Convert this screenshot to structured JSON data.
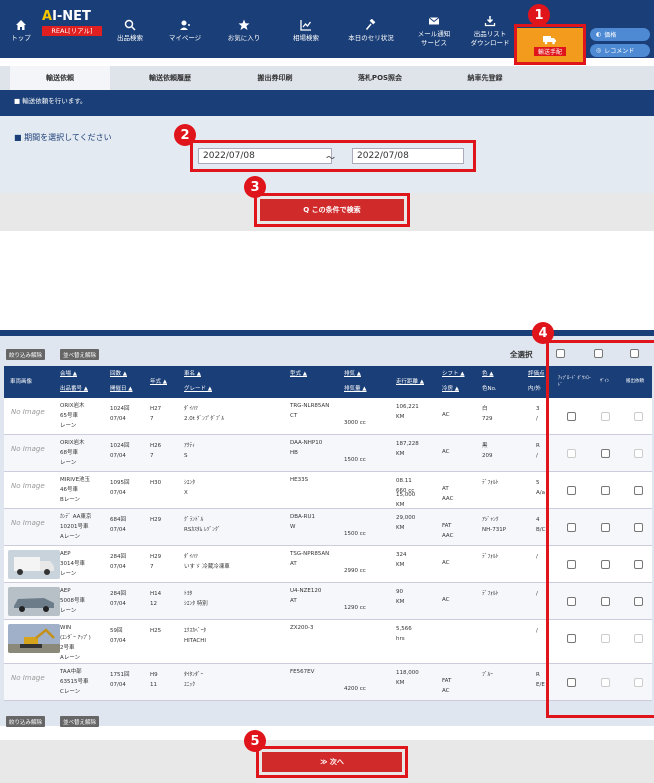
{
  "header": {
    "logo_main": "AI-NET",
    "logo_sub": "REAL[リアル]",
    "nav": [
      {
        "label": "トップ",
        "icon": "home-icon"
      },
      {
        "label": "出品検索",
        "icon": "search-icon"
      },
      {
        "label": "マイページ",
        "icon": "user-icon"
      },
      {
        "label": "お気に入り",
        "icon": "star-icon"
      },
      {
        "label": "相場検索",
        "icon": "chart-icon"
      },
      {
        "label": "本日のセリ状況",
        "icon": "hammer-icon"
      },
      {
        "label": "メール通知\nサービス",
        "icon": "mail-icon"
      },
      {
        "label": "出品リスト\nダウンロード",
        "icon": "download-icon"
      }
    ],
    "transport_label": "輸送手配",
    "pill_1": "価格",
    "pill_2": "レコメンド"
  },
  "tabs": [
    "輸送依頼",
    "輸送依頼履歴",
    "搬出券印刷",
    "落札POS照会",
    "納車先登録"
  ],
  "banner_text": "■ 輸送依頼を行います。",
  "filter": {
    "label": "■ 期間を選択してください",
    "date_from": "2022/07/08",
    "tilde": "～",
    "date_to": "2022/07/08",
    "search_label": "Q この条件で検索"
  },
  "table": {
    "btn_filter_clear": "絞り込み解除",
    "btn_sort_clear": "並べ替え解除",
    "select_all": "全選択",
    "headers": {
      "image": "車両画像",
      "venue": "会場 ▲",
      "venue2": "出品番号 ▲",
      "count": "回数 ▲",
      "date": "開催日 ▲",
      "year": "年式 ▲",
      "model": "車名 ▲",
      "grade": "グレード ▲",
      "type": "型式 ▲",
      "cc": "排気 ▲",
      "cc2": "排気量 ▲",
      "mileage": "走行距離 ▲",
      "shift": "シフト ▲",
      "ac": "冷房 ▲",
      "color": "色 ▲",
      "colorno": "色No.",
      "eval": "評価点",
      "eval2": "内/外",
      "ck1": "ｱｯﾌﾟﾛｰﾄﾞ ﾀﾞｳﾝﾛｰﾄﾞ",
      "ck2": "ｻﾞｲﾝ",
      "ck3": "搬出依頼"
    },
    "rows": [
      {
        "img": "No Image",
        "venue": "ORIX岩木\n65号車\nレーン",
        "count": "1024回\n07/04",
        "year": "H27\n7",
        "model": "ﾀﾞｲﾊﾂ\n2.0t ﾀﾞﾝﾌﾟﾀﾞﾌﾞﾙ",
        "type": "TRG-NLR85AN\nCT",
        "cc": "3000 cc",
        "km": "106,221\nKM",
        "shift": "AC",
        "color": "白\n729",
        "eval": "3\n/"
      },
      {
        "img": "No Image",
        "venue": "ORIX岩木\n68号車\nレーン",
        "count": "1024回\n07/04",
        "year": "H26\n7",
        "model": "ｱｸﾃｨ\nS",
        "type": "DAA-NHP10\nHB",
        "cc": "1500 cc",
        "km": "187,228\nKM",
        "shift": "AC",
        "color": "黒\n209",
        "eval": "R\n/"
      },
      {
        "img": "No Image",
        "venue": "MIRIVE池玉\n46号車\nBレーン",
        "count": "1095回\n07/04",
        "year": "H30",
        "model": "ｼｴﾝﾀ\nX",
        "type": "HE33S",
        "cc": "",
        "km": "08.11\n660 cc",
        "shift": "AT\nAAC",
        "color": "ﾃﾞﾌｫﾙﾄ",
        "eval": "5\nA/a",
        "km2": "15,000\nKM"
      },
      {
        "img": "No Image",
        "venue": "ｶﾝﾃﾞ AA東京\n10201号車\nAレーン",
        "count": "684回\n07/04",
        "year": "H29",
        "model": "ｸﾞﾗﾝﾄﾞﾙ\nRSｶｽﾀﾑ ﾚﾂﾞﾝｸﾞ",
        "type": "DBA-RU1\nW",
        "cc": "1500 cc",
        "km": "29,000\nKM",
        "shift": "FAT\nAAC",
        "color": "ｱｼﾞｬﾝｸ\nNH-731P",
        "eval": "4\nB/C"
      },
      {
        "img": "truck1",
        "venue": "AEP\n3014号車\nレーン",
        "count": "284回\n07/04",
        "year": "H29\n7",
        "model": "ﾀﾞｲﾊﾂ\nいすゞ 冷蔵冷凍車",
        "type": "TSG-NPR85AN\nAT",
        "cc": "2990 cc",
        "km": "324\nKM",
        "shift": "AC",
        "color": "ﾃﾞﾌｫﾙﾄ",
        "eval": "/"
      },
      {
        "img": "car1",
        "venue": "AEP\n5008号車\nレーン",
        "count": "284回\n07/04",
        "year": "H14\n12",
        "model": "ﾄﾖﾀ\nｼｴﾝﾀ 特別",
        "type": "U4-NZE120\nAT",
        "cc": "1290 cc",
        "km": "90\nKM",
        "shift": "AC",
        "color": "ﾃﾞﾌｫﾙﾄ",
        "eval": "/"
      },
      {
        "img": "excavator",
        "venue": "WIN\n(ｴﾝﾀﾞｰ ｱｯﾌﾟ)\n2号車\nAレーン",
        "count": "59回\n07/04",
        "year": "H25",
        "model": "ｴｸｽｶﾍﾞｰﾀ\nHITACHI",
        "type": "ZX200-3",
        "cc": "",
        "km": "5,566\nhrs",
        "shift": "",
        "color": "",
        "eval": "/"
      },
      {
        "img": "No Image",
        "venue": "TAA中部\n63515号車\nCレーン",
        "count": "1751回\n07/04",
        "year": "H9\n11",
        "model": "ﾀｲﾀﾝﾀﾞｰ\nﾕﾆｯｸ",
        "type": "FE567EV",
        "cc": "4200 cc",
        "km": "118,000\nKM",
        "shift": "FAT\nAC",
        "color": "ﾌﾞﾙｰ",
        "eval": "R\nE/E"
      }
    ]
  },
  "next_label": "≫ 次へ",
  "badges": [
    "1",
    "2",
    "3",
    "4",
    "5"
  ]
}
